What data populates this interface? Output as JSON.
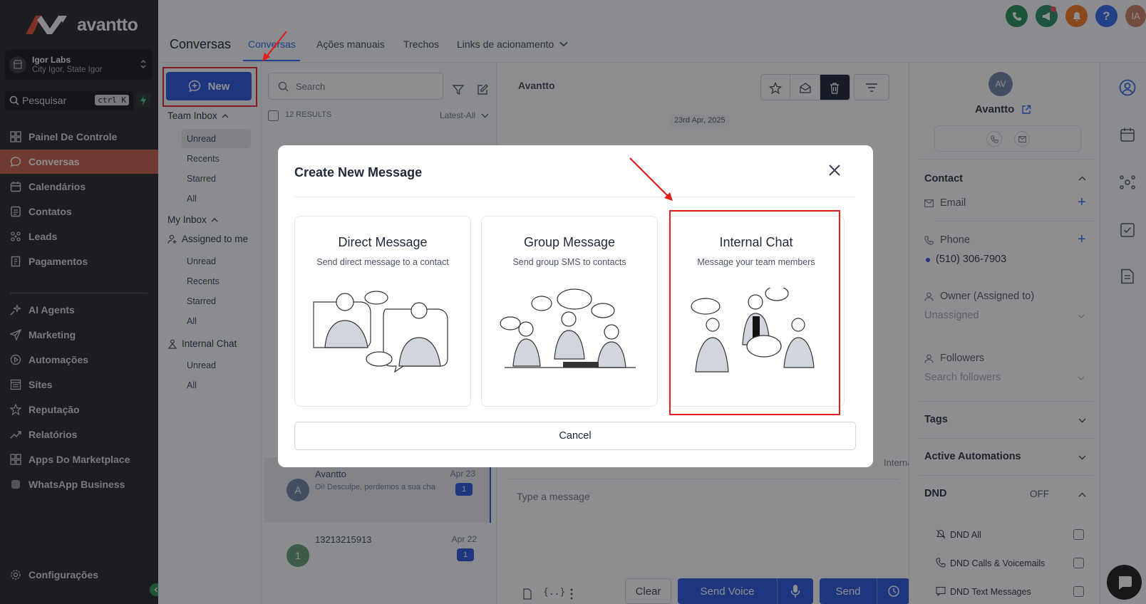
{
  "brand": {
    "name": "avantto"
  },
  "account": {
    "name": "Igor Labs",
    "location": "City Igor, State Igor"
  },
  "sidebar_search": {
    "placeholder": "Pesquisar",
    "shortcut": "ctrl K"
  },
  "nav": {
    "primary": [
      {
        "label": "Painel De Controle",
        "icon": "dashboard-icon"
      },
      {
        "label": "Conversas",
        "icon": "chat-icon",
        "active": true
      },
      {
        "label": "Calendários",
        "icon": "calendar-icon"
      },
      {
        "label": "Contatos",
        "icon": "contacts-icon"
      },
      {
        "label": "Leads",
        "icon": "leads-icon"
      },
      {
        "label": "Pagamentos",
        "icon": "payments-icon"
      }
    ],
    "secondary": [
      {
        "label": "AI Agents",
        "icon": "sparkle-icon"
      },
      {
        "label": "Marketing",
        "icon": "send-icon"
      },
      {
        "label": "Automações",
        "icon": "automation-icon"
      },
      {
        "label": "Sites",
        "icon": "sites-icon"
      },
      {
        "label": "Reputação",
        "icon": "star-icon"
      },
      {
        "label": "Relatórios",
        "icon": "trend-icon"
      },
      {
        "label": "Apps Do Marketplace",
        "icon": "grid-icon"
      },
      {
        "label": "WhatsApp Business",
        "icon": "whatsapp-icon"
      }
    ],
    "settings": "Configurações"
  },
  "header": {
    "title": "Conversas",
    "tabs": [
      "Conversas",
      "Ações manuais",
      "Trechos",
      "Links de acionamento"
    ],
    "user_initials": "IA"
  },
  "inbox": {
    "new_button": "New",
    "team_inbox": {
      "label": "Team Inbox",
      "items": [
        "Unread",
        "Recents",
        "Starred",
        "All"
      ]
    },
    "my_inbox": {
      "label": "My Inbox",
      "assigned": "Assigned to me",
      "items": [
        "Unread",
        "Recents",
        "Starred",
        "All"
      ]
    },
    "internal_chat": {
      "label": "Internal Chat",
      "items": [
        "Unread",
        "All"
      ]
    }
  },
  "list": {
    "search_placeholder": "Search",
    "results": "12 RESULTS",
    "sort": "Latest-All",
    "conversations": [
      {
        "avatar": "A",
        "name": "Avantto",
        "preview": "Oi! Desculpe, perdemos a sua cha",
        "date": "Apr 23",
        "count": "1",
        "color": "#6b7fa3"
      },
      {
        "avatar": "1",
        "name": "13213215913",
        "preview": "",
        "date": "Apr 22",
        "count": "1",
        "color": "#5b9b6b"
      }
    ]
  },
  "chat": {
    "title": "Avantto",
    "date": "23rd Apr, 2025",
    "placeholder": "Type a message",
    "internal_comment": "Internal Comment",
    "clear": "Clear",
    "send_voice": "Send Voice",
    "send": "Send"
  },
  "contact": {
    "initials": "AV",
    "name": "Avantto",
    "section_contact": "Contact",
    "email_label": "Email",
    "phone_label": "Phone",
    "phone": "(510) 306-7903",
    "owner_label": "Owner (Assigned to)",
    "owner_value": "Unassigned",
    "followers_label": "Followers",
    "followers_placeholder": "Search followers",
    "tags": "Tags",
    "automations": "Active Automations",
    "dnd": "DND",
    "dnd_state": "OFF",
    "dnd_all": "DND All",
    "dnd_calls": "DND Calls & Voicemails",
    "dnd_text": "DND Text Messages"
  },
  "modal": {
    "title": "Create New Message",
    "cards": [
      {
        "title": "Direct Message",
        "desc": "Send direct message to a contact"
      },
      {
        "title": "Group Message",
        "desc": "Send group SMS to contacts"
      },
      {
        "title": "Internal Chat",
        "desc": "Message your team members"
      }
    ],
    "cancel": "Cancel"
  },
  "colors": {
    "brand_red": "#e0472f",
    "primary_blue": "#1d4ed8",
    "active_nav": "#c0563a",
    "highlight": "#e11d1d"
  }
}
